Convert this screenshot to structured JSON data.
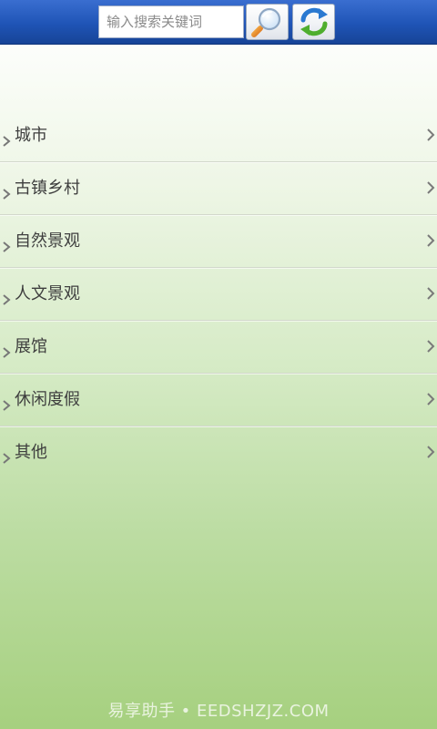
{
  "search": {
    "placeholder": "输入搜索关键词",
    "value": ""
  },
  "toolbar": {
    "search_button_icon": "magnifier-icon",
    "refresh_button_icon": "refresh-icon"
  },
  "categories": [
    {
      "label": "城市"
    },
    {
      "label": "古镇乡村"
    },
    {
      "label": "自然景观"
    },
    {
      "label": "人文景观"
    },
    {
      "label": "展馆"
    },
    {
      "label": "休闲度假"
    },
    {
      "label": "其他"
    }
  ],
  "watermark": "易享助手 • EEDSHZJZ.COM",
  "colors": {
    "header": "#1f54b6",
    "background_top": "#ffffff",
    "background_bottom": "#a6d07f",
    "text": "#3e3e3e"
  }
}
